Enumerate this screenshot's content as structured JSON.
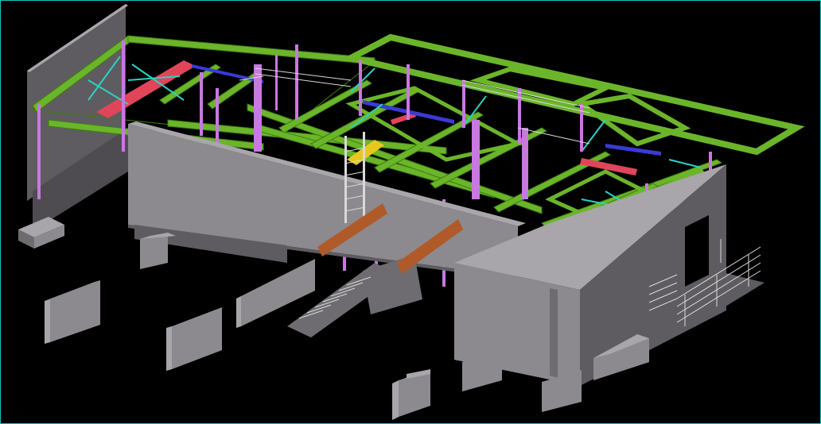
{
  "viewport": {
    "title": "",
    "background": "#000000",
    "frame_color": "#19c3c8"
  },
  "colors": {
    "wall_face": "#8c8a8e",
    "wall_side": "#5e5c60",
    "wall_top": "#a8a6aa",
    "beam": "#6bb52a",
    "beam_dark": "#3f7d12",
    "column": "#c878e0",
    "brace": "#2ad1c4",
    "rail": "#d9d9d9",
    "timber": "#b05a2a",
    "red_member": "#e0455a",
    "blue_member": "#3a3ad8",
    "yellow_plate": "#e8c81e"
  },
  "components": [
    "concrete-wall",
    "steel-beam",
    "steel-column",
    "bracing",
    "handrail",
    "stair",
    "footing",
    "timber-beam"
  ]
}
